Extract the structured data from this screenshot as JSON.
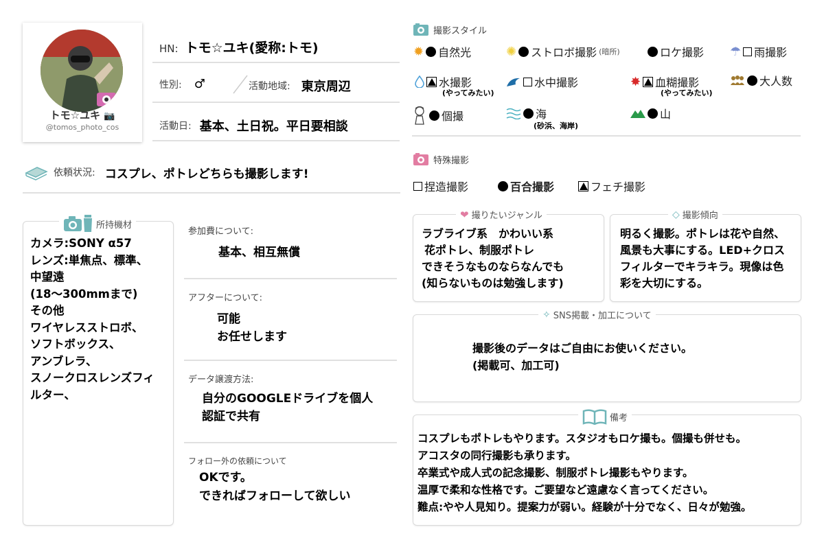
{
  "profile": {
    "name": "トモ☆ユキ",
    "handle": "@tomos_photo_cos",
    "hn_label": "HN:",
    "hn_value": "トモ☆ユキ(愛称:トモ)",
    "gender_label": "性別:",
    "gender_value": "♂",
    "area_label": "活動地域:",
    "area_value": "東京周辺",
    "days_label": "活動日:",
    "days_value": "基本、土日祝。平日要相談"
  },
  "request": {
    "label": "依頼状況:",
    "value": "コスプレ、ポトレどちらも撮影します!"
  },
  "equipment": {
    "title": "所持機材",
    "lines": [
      "カメラ:SONY α57",
      "レンズ:単焦点、標準、",
      "中望遠",
      "(18～300mmまで)",
      "その他",
      "ワイヤレスストロボ、",
      "ソフトボックス、",
      "アンブレラ、",
      "スノークロスレンズフィ",
      "ルター、"
    ]
  },
  "fee": {
    "label": "参加費について:",
    "value": "基本、相互無償"
  },
  "after": {
    "label": "アフターについて:",
    "lines": [
      "可能",
      "お任せします"
    ]
  },
  "data_transfer": {
    "label": "データ譲渡方法:",
    "lines": [
      "自分のGOOGLEドライブを個人",
      "認証で共有"
    ]
  },
  "non_follow": {
    "label": "フォロー外の依頼について",
    "lines": [
      "OKです。",
      "できればフォローして欲しい"
    ]
  },
  "styles": {
    "title": "撮影スタイル",
    "items": {
      "natural": {
        "label": "自然光",
        "mark": "dot",
        "icon": "sun-icon"
      },
      "strobe": {
        "label": "ストロボ撮影",
        "note": "(暗所)",
        "mark": "dot",
        "icon": "sparkle-icon"
      },
      "location": {
        "label": "ロケ撮影",
        "mark": "dot"
      },
      "rain": {
        "label": "雨撮影",
        "mark": "box",
        "icon": "umbrella-icon"
      },
      "water": {
        "label": "水撮影",
        "sub": "(やってみたい)",
        "mark": "triangle",
        "icon": "water-drop-icon"
      },
      "underwater": {
        "label": "水中撮影",
        "mark": "box",
        "icon": "wave-icon"
      },
      "blood": {
        "label": "血糊撮影",
        "sub": "(やってみたい)",
        "mark": "triangle",
        "icon": "splash-icon"
      },
      "group": {
        "label": "大人数",
        "mark": "dot",
        "icon": "people-icon"
      },
      "individual": {
        "label": "個撮",
        "mark": "dot",
        "icon": "person-icon"
      },
      "sea": {
        "label": "海",
        "sub": "(砂浜、海岸)",
        "mark": "dot",
        "icon": "sea-icon"
      },
      "mountain": {
        "label": "山",
        "mark": "dot",
        "icon": "mountain-icon"
      }
    }
  },
  "special": {
    "title": "特殊撮影",
    "items": {
      "fake": {
        "label": "捏造撮影",
        "mark": "box"
      },
      "yuri": {
        "label": "百合撮影",
        "mark": "dot"
      },
      "fetish": {
        "label": "フェチ撮影",
        "mark": "triangle"
      }
    }
  },
  "genre": {
    "title": "撮りたいジャンル",
    "lines": [
      "ラブライブ系　かわいい系",
      "花ポトレ、制服ポトレ",
      "できそうなものならなんでも",
      "(知らないものは勉強します)"
    ]
  },
  "tendency": {
    "title": "撮影傾向",
    "lines": [
      "明るく撮影。ポトレは花や自然、",
      "風景も大事にする。LED+クロス",
      "フィルターでキラキラ。現像は色",
      "彩を大切にする。"
    ]
  },
  "sns": {
    "title": "SNS掲載・加工について",
    "lines": [
      "撮影後のデータはご自由にお使いください。",
      "(掲載可、加工可)"
    ]
  },
  "notes": {
    "title": "備考",
    "lines": [
      "コスプレもポトレもやります。スタジオもロケ撮も。個撮も併せも。",
      "アコスタの同行撮影も承ります。",
      "卒業式や成人式の記念撮影、制服ポトレ撮影もやります。",
      "温厚で柔和な性格です。ご要望など遠慮なく言ってください。",
      "難点:やや人見知り。提案力が弱い。経験が十分でなく、日々が勉強。"
    ]
  },
  "colors": {
    "accent_pink": "#e27da2",
    "accent_teal": "#6fb5b8",
    "divider": "#e0e0e0"
  }
}
